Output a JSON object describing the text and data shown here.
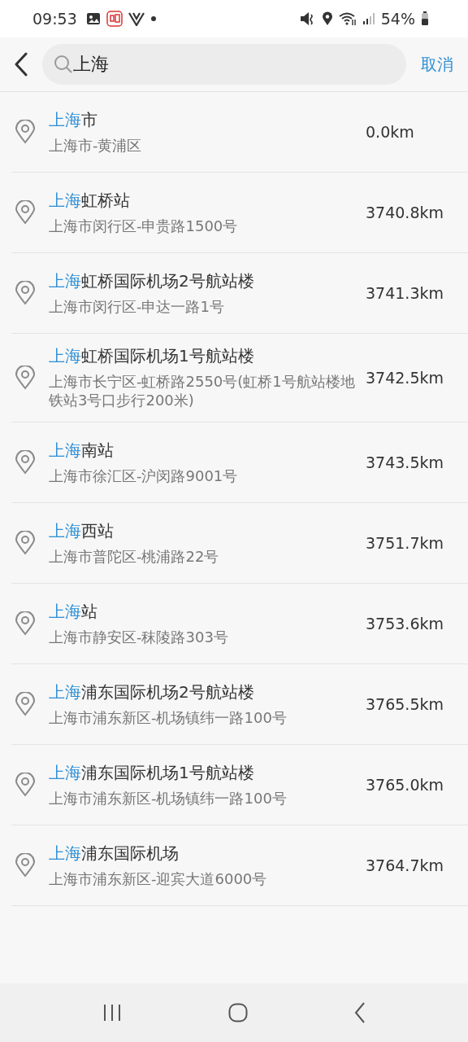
{
  "status_bar": {
    "time": "09:53",
    "battery": "54%"
  },
  "search": {
    "value": "上海",
    "cancel": "取消"
  },
  "results": [
    {
      "match": "上海",
      "rest": "市",
      "address": "上海市-黄浦区",
      "distance": "0.0km"
    },
    {
      "match": "上海",
      "rest": "虹桥站",
      "address": "上海市闵行区-申贵路1500号",
      "distance": "3740.8km"
    },
    {
      "match": "上海",
      "rest": "虹桥国际机场2号航站楼",
      "address": "上海市闵行区-申达一路1号",
      "distance": "3741.3km"
    },
    {
      "match": "上海",
      "rest": "虹桥国际机场1号航站楼",
      "address": "上海市长宁区-虹桥路2550号(虹桥1号航站楼地铁站3号口步行200米)",
      "distance": "3742.5km"
    },
    {
      "match": "上海",
      "rest": "南站",
      "address": "上海市徐汇区-沪闵路9001号",
      "distance": "3743.5km"
    },
    {
      "match": "上海",
      "rest": "西站",
      "address": "上海市普陀区-桃浦路22号",
      "distance": "3751.7km"
    },
    {
      "match": "上海",
      "rest": "站",
      "address": "上海市静安区-秣陵路303号",
      "distance": "3753.6km"
    },
    {
      "match": "上海",
      "rest": "浦东国际机场2号航站楼",
      "address": "上海市浦东新区-机场镇纬一路100号",
      "distance": "3765.5km"
    },
    {
      "match": "上海",
      "rest": "浦东国际机场1号航站楼",
      "address": "上海市浦东新区-机场镇纬一路100号",
      "distance": "3765.0km"
    },
    {
      "match": "上海",
      "rest": "浦东国际机场",
      "address": "上海市浦东新区-迎宾大道6000号",
      "distance": "3764.7km"
    }
  ]
}
